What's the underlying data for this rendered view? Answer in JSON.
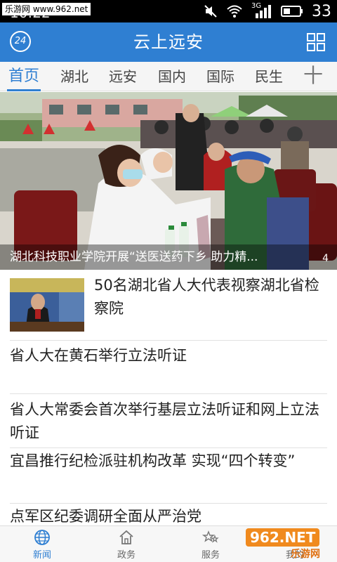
{
  "status_bar": {
    "watermark": "乐游网 www.962.net",
    "time": "10:22",
    "network": "3G",
    "battery": "33"
  },
  "app_bar": {
    "badge": "24",
    "title": "云上远安"
  },
  "tabs": [
    {
      "label": "首页"
    },
    {
      "label": "湖北"
    },
    {
      "label": "远安"
    },
    {
      "label": "国内"
    },
    {
      "label": "国际"
    },
    {
      "label": "民生"
    }
  ],
  "tab_add": "十",
  "banner": {
    "caption": "湖北科技职业学院开展“送医送药下乡 助力精...",
    "page_count": "4"
  },
  "news": [
    {
      "title": "50名湖北省人大代表视察湖北省检察院"
    },
    {
      "title": "省人大在黄石举行立法听证"
    },
    {
      "title": "省人大常委会首次举行基层立法听证和网上立法听证"
    },
    {
      "title": "宜昌推行纪检派驻机构改革 实现“四个转变”"
    },
    {
      "title": "点军区纪委调研全面从严治党"
    }
  ],
  "bottom_nav": [
    {
      "label": "新闻"
    },
    {
      "label": "政务"
    },
    {
      "label": "服务"
    },
    {
      "label": "我的"
    }
  ],
  "corner_watermark": {
    "brand": "962.NET",
    "sub": "乐游网"
  },
  "colors": {
    "primary": "#2f7fd2",
    "status_bar": "#000000",
    "tab_bg": "#f5f5f5"
  },
  "icons": {
    "app_bar_menu": "grid-icon",
    "nav_news": "globe-icon",
    "nav_gov": "home-icon",
    "nav_service": "stars-icon",
    "nav_me": "person-icon"
  }
}
